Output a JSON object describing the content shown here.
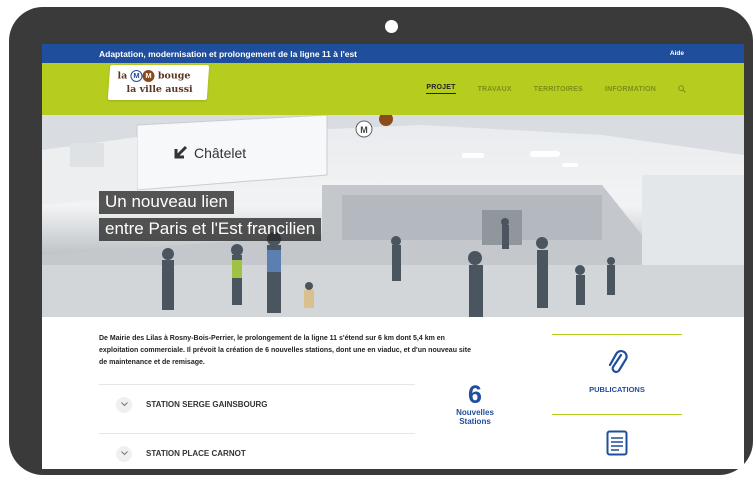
{
  "topbar": {
    "text": "Adaptation, modernisation et prolongement de la ligne 11 à l'est",
    "help": "Aide"
  },
  "logo": {
    "line1_pre": "la",
    "m_letter": "M",
    "line1_post": "bouge",
    "line2": "la ville aussi"
  },
  "nav": {
    "items": [
      "PROJET",
      "TRAVAUX",
      "TERRITOIRES",
      "INFORMATION"
    ],
    "active": "PROJET",
    "search_icon": "search-icon"
  },
  "hero": {
    "sign": "Châtelet",
    "title_line1": "Un nouveau lien",
    "title_line2": "entre Paris et l'Est francilien"
  },
  "intro": "De Mairie des Lilas à Rosny-Bois-Perrier, le prolongement de la ligne 11 s'étend sur 6 km dont 5,4 km en exploitation commerciale. Il prévoit la création de 6 nouvelles stations, dont une en viaduc, et d'un nouveau site de maintenance et de remisage.",
  "stations": [
    "STATION SERGE GAINSBOURG",
    "STATION PLACE CARNOT"
  ],
  "stat": {
    "number": "6",
    "label_line1": "Nouvelles",
    "label_line2": "Stations"
  },
  "side": {
    "publications": "PUBLICATIONS"
  },
  "colors": {
    "blue": "#1f4e9c",
    "lime": "#b6cc1f",
    "frame": "#3a3a3a"
  }
}
